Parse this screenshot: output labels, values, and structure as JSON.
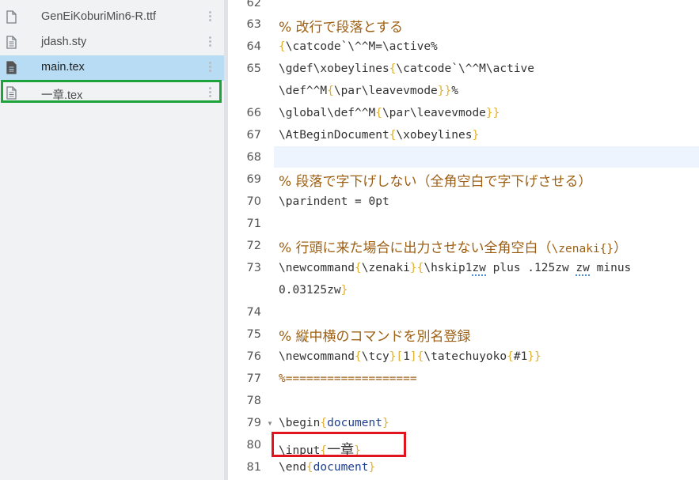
{
  "sidebar": {
    "files": [
      {
        "name": "GenEiKoburiMin6-R.ttf",
        "icon": "file-icon",
        "active": false
      },
      {
        "name": "jdash.sty",
        "icon": "file-text-icon",
        "active": false
      },
      {
        "name": "main.tex",
        "icon": "file-text-icon",
        "active": true
      },
      {
        "name": "一章.tex",
        "icon": "file-text-icon",
        "active": false
      }
    ]
  },
  "editor": {
    "line_numbers": [
      "62",
      "63",
      "64",
      "65",
      "66",
      "67",
      "68",
      "69",
      "70",
      "71",
      "72",
      "73",
      "74",
      "75",
      "76",
      "77",
      "78",
      "79",
      "80",
      "81"
    ],
    "lines": {
      "l63": "% 改行で段落とする",
      "l64a": "\\catcode`\\^^M=\\active%",
      "l65a": "\\gdef\\xobeylines",
      "l65b": "\\catcode`\\^^M\\active",
      "l65c": "\\def^^M",
      "l65d": "\\par\\leavevmode",
      "l66a": "\\global\\def^^M",
      "l66b": "\\par\\leavevmode",
      "l67a": "\\AtBeginDocument",
      "l67b": "\\xobeylines",
      "l69": "% 段落で字下げしない（全角空白で字下げさせる）",
      "l70": "\\parindent = 0pt",
      "l72a": "% 行頭に来た場合に出力させない全角空白（",
      "l72b": "\\zenaki{}",
      "l72c": "）",
      "l73a": "\\newcommand",
      "l73b": "\\zenaki",
      "l73c": "\\hskip1",
      "l73d": "zw",
      "l73e": " plus .125zw ",
      "l73f": "minus",
      "l73g": "0.03125zw",
      "l75": "% 縦中横のコマンドを別名登録",
      "l76a": "\\newcommand",
      "l76b": "\\tcy",
      "l76c": "1",
      "l76d": "\\tatechuyoko",
      "l76e": "#1",
      "l77": "%===================",
      "l79a": "\\begin",
      "l79b": "document",
      "l80a": "\\input",
      "l80b": "一章",
      "l81a": "\\end",
      "l81b": "document"
    }
  },
  "colors": {
    "highlight_box": "#e0151f",
    "selection_box": "#1ca33a",
    "active_file_bg": "#b8dcf3"
  }
}
